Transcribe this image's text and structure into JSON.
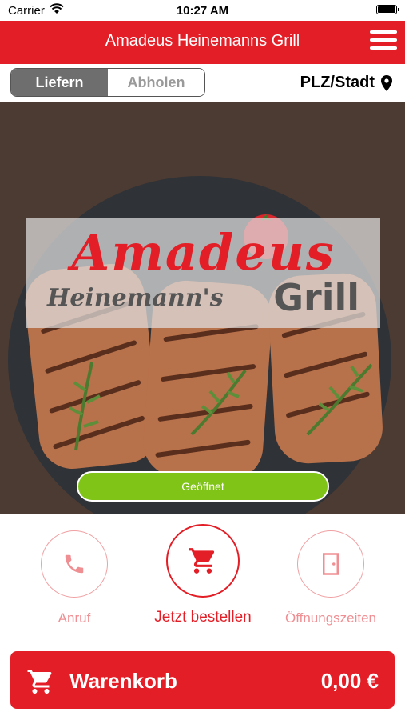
{
  "status_bar": {
    "carrier": "Carrier",
    "time": "10:27 AM"
  },
  "header": {
    "title": "Amadeus Heinemanns Grill"
  },
  "mode_toggle": {
    "options": [
      "Liefern",
      "Abholen"
    ],
    "selected": "Liefern"
  },
  "location": {
    "label": "PLZ/Stadt"
  },
  "hero": {
    "logo_main": "Amadeus",
    "logo_sub": "Heinemann's",
    "logo_grill": "Grill",
    "status_button": "Geöffnet"
  },
  "actions": [
    {
      "label": "Anruf",
      "icon": "phone-icon"
    },
    {
      "label": "Jetzt bestellen",
      "icon": "cart-icon"
    },
    {
      "label": "Öffnungszeiten",
      "icon": "door-icon"
    }
  ],
  "cart": {
    "label": "Warenkorb",
    "total": "0,00 €"
  },
  "colors": {
    "brand_red": "#e41e26",
    "open_green": "#7fc416",
    "muted_red": "#ef8f93"
  }
}
